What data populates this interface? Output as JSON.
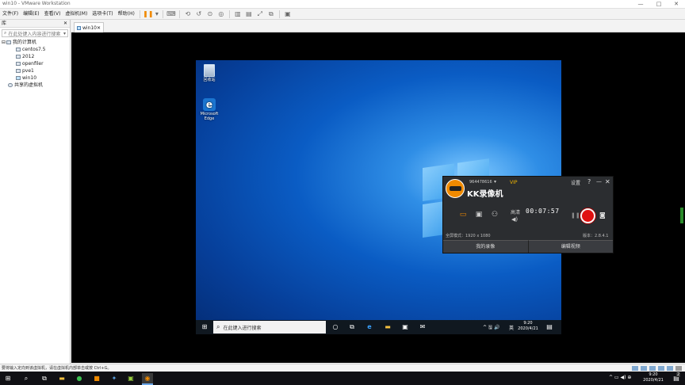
{
  "titlebar": {
    "title": "win10 - VMware Workstation",
    "minimize": "—",
    "maximize": "□",
    "close": "✕"
  },
  "menu": {
    "items": [
      "文件(F)",
      "编辑(E)",
      "查看(V)",
      "虚拟机(M)",
      "选项卡(T)",
      "帮助(H)"
    ],
    "pause_icon": "pause-icon"
  },
  "library": {
    "title": "库",
    "close": "✕",
    "search_placeholder": "在此处键入内容进行搜索",
    "root": "我的计算机",
    "vms": [
      "centos7.5",
      "2012",
      "openfiler",
      "pve1",
      "win10"
    ],
    "shared": "共享的虚拟机"
  },
  "tab": {
    "label": "win10",
    "close": "✕"
  },
  "desktop": {
    "icons": [
      {
        "label": "回收站"
      },
      {
        "label": "Microsoft Edge"
      }
    ]
  },
  "guest_taskbar": {
    "search_placeholder": "在此键入进行搜索",
    "time": "9:20",
    "date": "2020/4/21",
    "lang": "英",
    "tray": "^ 🖫 🔊"
  },
  "kk": {
    "account": "964478616",
    "vip": "VIP",
    "settings": "设置",
    "help": "?",
    "minimize": "—",
    "close": "✕",
    "brand": "KK录像机",
    "quality": "高清",
    "timer": "00:07:57",
    "fullscreen_mode": "全屏模式：1920 x 1080",
    "version": "版本：2.8.4.1",
    "my_recordings": "我的录像",
    "edit_video": "编辑视频"
  },
  "statusbar": {
    "text": "要将输入定向到该虚拟机，请在虚拟机内部单击或按 Ctrl+G。"
  },
  "host_taskbar": {
    "time": "9:20",
    "date": "2020/4/21",
    "notification_count": "2"
  },
  "colors": {
    "record_red": "#e01010",
    "accent_orange": "#f08a00",
    "desktop_blue": "#0a5cc4"
  }
}
